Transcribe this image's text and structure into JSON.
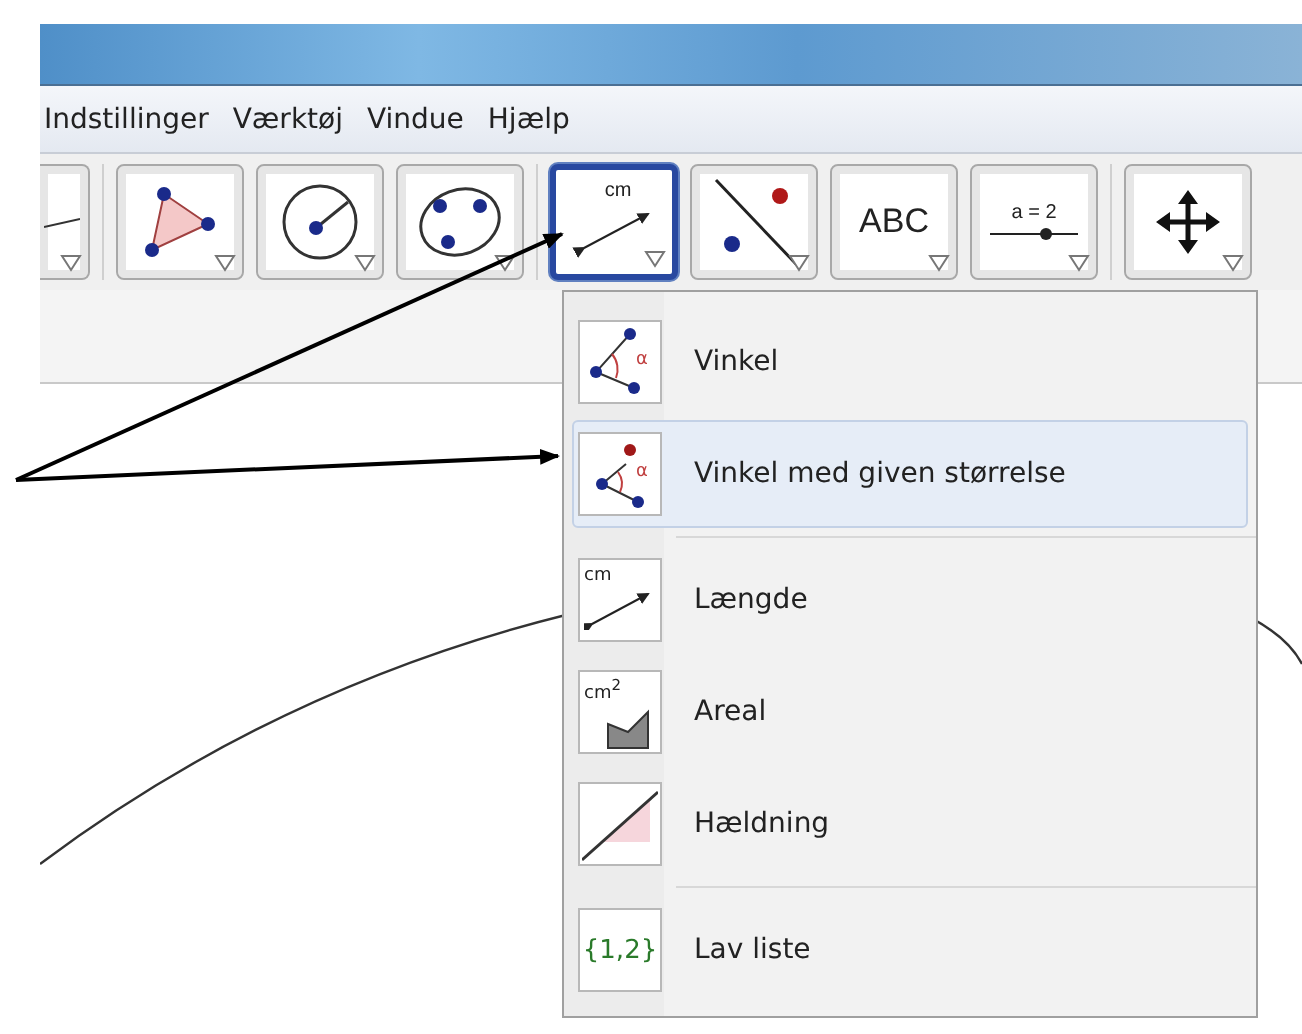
{
  "menu_bar": [
    "Indstillinger",
    "Værktøj",
    "Vindue",
    "Hjælp"
  ],
  "toolbar": [
    [
      {
        "kind": "line",
        "selected": false,
        "partial": true
      }
    ],
    [
      {
        "kind": "polygon",
        "selected": false
      },
      {
        "kind": "circle",
        "selected": false
      },
      {
        "kind": "conic",
        "selected": false
      }
    ],
    [
      {
        "kind": "measure",
        "selected": true,
        "text": "cm"
      },
      {
        "kind": "reflect",
        "selected": false
      },
      {
        "kind": "text",
        "selected": false,
        "text": "ABC"
      },
      {
        "kind": "slider",
        "selected": false,
        "text": "a = 2"
      }
    ],
    [
      {
        "kind": "move",
        "selected": false
      }
    ]
  ],
  "dropdown": [
    [
      {
        "kind": "angle",
        "label": "Vinkel",
        "selected": false,
        "icon_text": "α"
      },
      {
        "kind": "angle_fixed",
        "label": "Vinkel med given størrelse",
        "selected": true,
        "icon_text": "α"
      }
    ],
    [
      {
        "kind": "distance",
        "label": "Længde",
        "selected": false,
        "icon_text": "cm"
      },
      {
        "kind": "area",
        "label": "Areal",
        "selected": false,
        "icon_text": "cm$^{2}$"
      },
      {
        "kind": "slope",
        "label": "Hældning",
        "selected": false
      }
    ],
    [
      {
        "kind": "list",
        "label": "Lav liste",
        "selected": false,
        "icon_text": "{1,2}"
      }
    ]
  ]
}
